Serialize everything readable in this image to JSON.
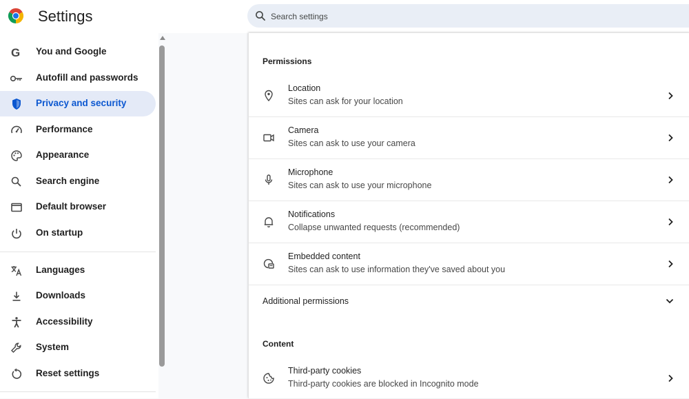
{
  "header": {
    "title": "Settings",
    "search_placeholder": "Search settings"
  },
  "sidebar": {
    "items": [
      {
        "label": "You and Google",
        "icon": "google-g-icon"
      },
      {
        "label": "Autofill and passwords",
        "icon": "key-icon"
      },
      {
        "label": "Privacy and security",
        "icon": "shield-icon",
        "active": true
      },
      {
        "label": "Performance",
        "icon": "speedometer-icon"
      },
      {
        "label": "Appearance",
        "icon": "palette-icon"
      },
      {
        "label": "Search engine",
        "icon": "search-icon"
      },
      {
        "label": "Default browser",
        "icon": "browser-window-icon"
      },
      {
        "label": "On startup",
        "icon": "power-icon"
      },
      {
        "label": "Languages",
        "icon": "translate-icon"
      },
      {
        "label": "Downloads",
        "icon": "download-icon"
      },
      {
        "label": "Accessibility",
        "icon": "accessibility-icon"
      },
      {
        "label": "System",
        "icon": "wrench-icon"
      },
      {
        "label": "Reset settings",
        "icon": "reset-icon"
      }
    ]
  },
  "main": {
    "permissions_title": "Permissions",
    "permissions": [
      {
        "title": "Location",
        "subtitle": "Sites can ask for your location",
        "icon": "location-pin-icon"
      },
      {
        "title": "Camera",
        "subtitle": "Sites can ask to use your camera",
        "icon": "camera-icon"
      },
      {
        "title": "Microphone",
        "subtitle": "Sites can ask to use your microphone",
        "icon": "microphone-icon"
      },
      {
        "title": "Notifications",
        "subtitle": "Collapse unwanted requests (recommended)",
        "icon": "bell-icon"
      },
      {
        "title": "Embedded content",
        "subtitle": "Sites can ask to use information they've saved about you",
        "icon": "embedded-content-icon"
      }
    ],
    "additional_permissions": "Additional permissions",
    "content_title": "Content",
    "content": [
      {
        "title": "Third-party cookies",
        "subtitle": "Third-party cookies are blocked in Incognito mode",
        "icon": "cookie-icon"
      }
    ]
  },
  "colors": {
    "accent": "#0b57d0",
    "active_bg": "#e4eaf7",
    "search_bg": "#e9eef6"
  }
}
